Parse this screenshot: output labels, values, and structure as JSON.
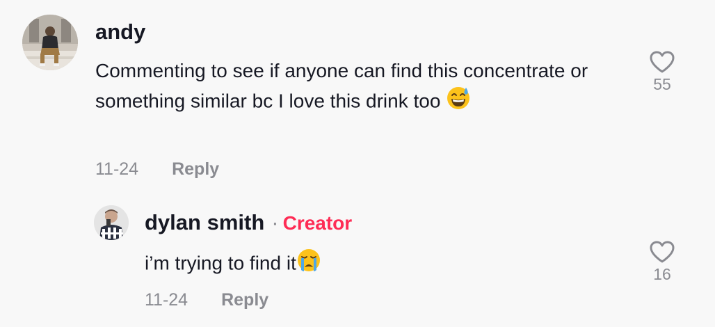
{
  "comments": [
    {
      "username": "andy",
      "text": "Commenting to see if anyone can find this concentrate or something similar bc I love this drink too",
      "emoji": "grinning-face-with-sweat",
      "date": "11-24",
      "reply_label": "Reply",
      "likes": "55"
    }
  ],
  "replies": [
    {
      "username": "dylan smith",
      "separator": "·",
      "badge": "Creator",
      "text": "i’m trying to find it",
      "emoji": "loudly-crying-face",
      "date": "11-24",
      "reply_label": "Reply",
      "likes": "16"
    }
  ],
  "colors": {
    "background": "#f8f8f8",
    "text": "#161823",
    "muted": "#8a8b91",
    "creator_badge": "#fe2c55"
  }
}
